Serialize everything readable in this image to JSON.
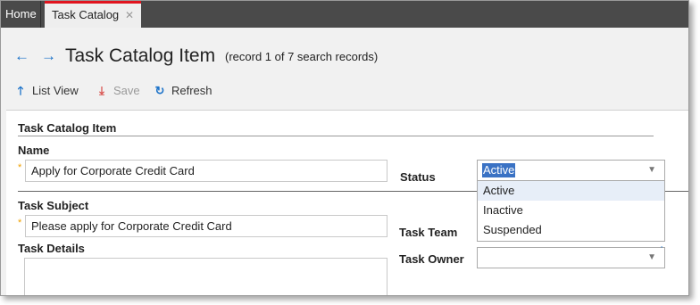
{
  "tabs": {
    "home": "Home",
    "active": "Task Catalog",
    "close_glyph": "✕"
  },
  "header": {
    "back_icon": "←",
    "forward_icon": "→",
    "title": "Task Catalog Item",
    "record_info": "(record 1 of 7 search records)"
  },
  "toolbar": {
    "list_view": "List View",
    "save": "Save",
    "refresh": "Refresh",
    "list_icon": "🡑",
    "save_icon": "⤓",
    "refresh_icon": "↻"
  },
  "form": {
    "section_title": "Task Catalog Item",
    "name_label": "Name",
    "name_value": "Apply for Corporate Credit Card",
    "required_mark": "*",
    "status_label": "Status",
    "status_value": "Active",
    "status_options": [
      "Active",
      "Inactive",
      "Suspended"
    ],
    "task_subject_label": "Task Subject",
    "task_subject_value": "Please apply for Corporate Credit Card",
    "task_details_label": "Task Details",
    "task_team_label": "Task Team",
    "task_owner_label": "Task Owner",
    "task_owner_value": ""
  },
  "colors": {
    "accent": "#1d73c9",
    "tab_indicator": "#e0141e",
    "tabbar_bg": "#4a4a4a",
    "selection": "#3a72c4"
  }
}
